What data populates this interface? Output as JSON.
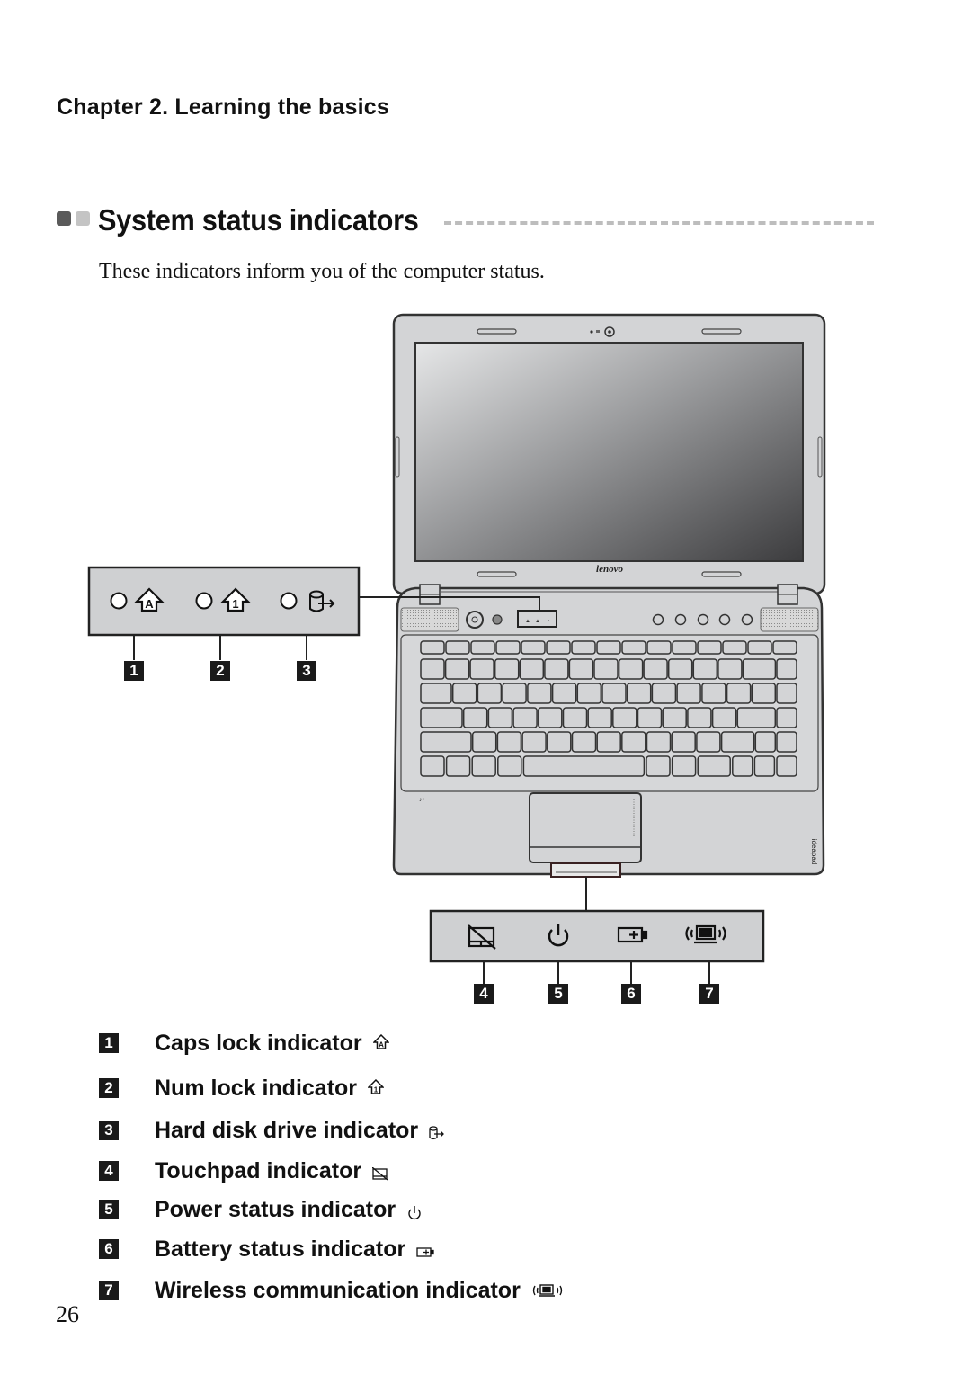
{
  "header": {
    "chapter": "Chapter 2. Learning the basics"
  },
  "section": {
    "title": "System status indicators",
    "intro": "These indicators inform you of the computer status."
  },
  "figure": {
    "brand_logo": "lenovo",
    "series_logo": "ideapad",
    "callouts": [
      "1",
      "2",
      "3",
      "4",
      "5",
      "6",
      "7"
    ]
  },
  "indicators": [
    {
      "number": "1",
      "label": "Caps lock indicator",
      "icon": "caps-lock-icon"
    },
    {
      "number": "2",
      "label": "Num lock indicator",
      "icon": "num-lock-icon"
    },
    {
      "number": "3",
      "label": "Hard disk drive indicator",
      "icon": "hard-disk-icon"
    },
    {
      "number": "4",
      "label": "Touchpad indicator",
      "icon": "touchpad-icon"
    },
    {
      "number": "5",
      "label": "Power status indicator",
      "icon": "power-icon"
    },
    {
      "number": "6",
      "label": "Battery status indicator",
      "icon": "battery-icon"
    },
    {
      "number": "7",
      "label": "Wireless communication indicator",
      "icon": "wireless-icon"
    }
  ],
  "footer": {
    "page_number": "26"
  },
  "colors": {
    "panel_gray": "#cfd0d2",
    "accent_dark": "#5a5a5a",
    "accent_light": "#c4c4c4",
    "badge": "#1a1a1a"
  }
}
